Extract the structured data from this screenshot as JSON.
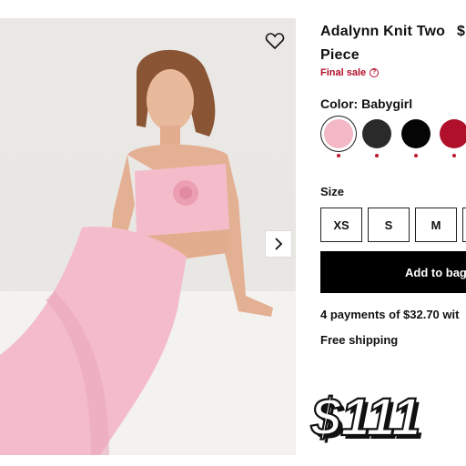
{
  "product": {
    "title_line1": "Adalynn Knit Two",
    "title_line2": "Piece",
    "price_partial": "$",
    "final_sale": "Final sale",
    "color_label": "Color: Babygirl",
    "size_label": "Size",
    "sizes": [
      "XS",
      "S",
      "M"
    ],
    "add_to_bag": "Add to bag",
    "payments": "4 payments of $32.70 wit",
    "shipping": "Free shipping"
  },
  "swatches": [
    {
      "name": "Babygirl",
      "color": "#f2b8c6",
      "selected": true
    },
    {
      "name": "charcoal",
      "color": "#2a2a2a",
      "selected": false
    },
    {
      "name": "black",
      "color": "#050505",
      "selected": false
    },
    {
      "name": "red",
      "color": "#b0102a",
      "selected": false
    }
  ],
  "overlay_price": "$111",
  "colors": {
    "accent_red": "#b3102a",
    "dress_pink": "#f4bccb",
    "button_black": "#000000"
  }
}
